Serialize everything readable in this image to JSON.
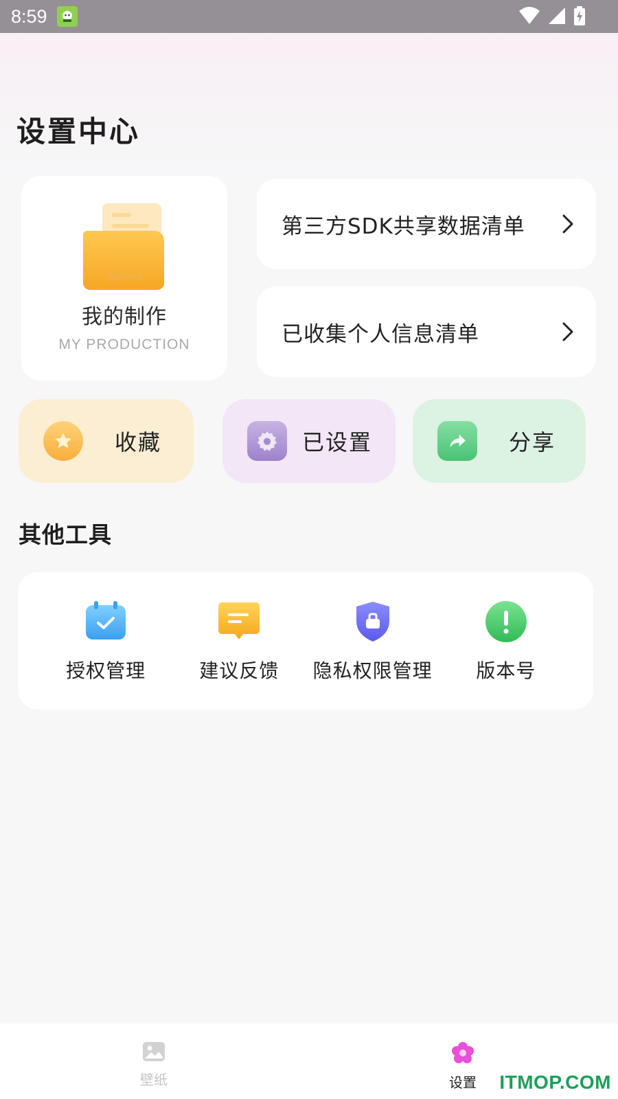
{
  "status_bar": {
    "time": "8:59"
  },
  "page": {
    "title": "设置中心"
  },
  "production_card": {
    "title": "我的制作",
    "subtitle": "MY PRODUCTION",
    "folder_text": "我的制作"
  },
  "links": [
    {
      "label": "第三方SDK共享数据清单"
    },
    {
      "label": "已收集个人信息清单"
    }
  ],
  "quick_actions": [
    {
      "label": "收藏",
      "icon": "star-icon",
      "bg": "#fbeed3"
    },
    {
      "label": "已设置",
      "icon": "gear-icon",
      "bg": "#f3e6f7"
    },
    {
      "label": "分享",
      "icon": "share-arrow-icon",
      "bg": "#dcf2e2"
    }
  ],
  "other_tools": {
    "title": "其他工具",
    "items": [
      {
        "label": "授权管理",
        "icon": "calendar-check-icon"
      },
      {
        "label": "建议反馈",
        "icon": "chat-bubble-icon"
      },
      {
        "label": "隐私权限管理",
        "icon": "shield-icon"
      },
      {
        "label": "版本号",
        "icon": "exclamation-icon"
      }
    ]
  },
  "bottom_nav": {
    "items": [
      {
        "label": "壁纸",
        "icon": "image-icon",
        "active": false
      },
      {
        "label": "设置",
        "icon": "flower-icon",
        "active": true
      }
    ],
    "accent": "#e94fd8"
  },
  "watermark": "ITMOP.COM"
}
